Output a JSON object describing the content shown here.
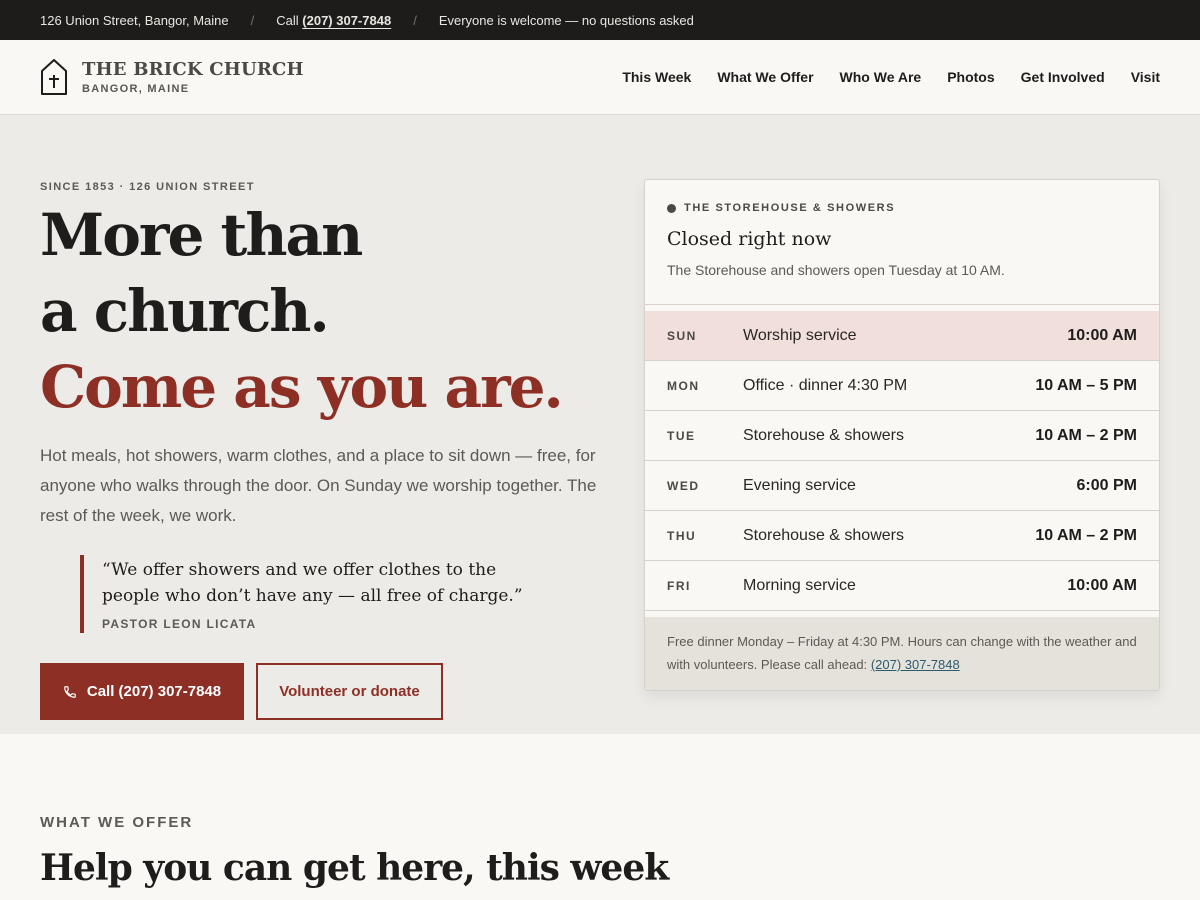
{
  "topbar": {
    "address": "126 Union Street, Bangor, Maine",
    "call_prefix": "Call",
    "phone": "(207) 307-7848",
    "welcome": "Everyone is welcome — no questions asked"
  },
  "brand": {
    "title": "THE BRICK CHURCH",
    "subtitle": "BANGOR, MAINE"
  },
  "nav": [
    "This Week",
    "What We Offer",
    "Who We Are",
    "Photos",
    "Get Involved",
    "Visit"
  ],
  "hero": {
    "eyebrow": "SINCE 1853 · 126 UNION STREET",
    "headline_1": "More than",
    "headline_2": "a church.",
    "headline_3": "Come as you are.",
    "lede": "Hot meals, hot showers, warm clothes, and a place to sit down — free, for anyone who walks through the door. On Sunday we worship together. The rest of the week, we work.",
    "quote": "“We offer showers and we offer clothes to the people who don’t have any — all free of charge.”",
    "quote_attribution": "PASTOR LEON LICATA",
    "call_button": "Call (207) 307-7848",
    "volunteer_button": "Volunteer or donate"
  },
  "status_card": {
    "eyebrow": "THE STOREHOUSE & SHOWERS",
    "status": "Closed right now",
    "note": "The Storehouse and showers open Tuesday at 10 AM.",
    "schedule": [
      {
        "day": "SUN",
        "what": "Worship service",
        "time": "10:00 AM",
        "today": true
      },
      {
        "day": "MON",
        "what": "Office · dinner 4:30 PM",
        "time": "10 AM – 5 PM",
        "today": false
      },
      {
        "day": "TUE",
        "what": "Storehouse & showers",
        "time": "10 AM – 2 PM",
        "today": false
      },
      {
        "day": "WED",
        "what": "Evening service",
        "time": "6:00 PM",
        "today": false
      },
      {
        "day": "THU",
        "what": "Storehouse & showers",
        "time": "10 AM – 2 PM",
        "today": false
      },
      {
        "day": "FRI",
        "what": "Morning service",
        "time": "10:00 AM",
        "today": false
      }
    ],
    "footer_text": "Free dinner Monday – Friday at 4:30 PM. Hours can change with the weather and with volunteers. Please call ahead:",
    "footer_phone": "(207) 307-7848"
  },
  "offer_section": {
    "eyebrow": "WHAT WE OFFER",
    "title": "Help you can get here, this week"
  },
  "colors": {
    "accent": "#8e2f26",
    "topbar_bg": "#1e1c1a",
    "hero_bg": "#ecebe7",
    "today_highlight": "#f1dfdb",
    "link": "#2d5a6e"
  }
}
